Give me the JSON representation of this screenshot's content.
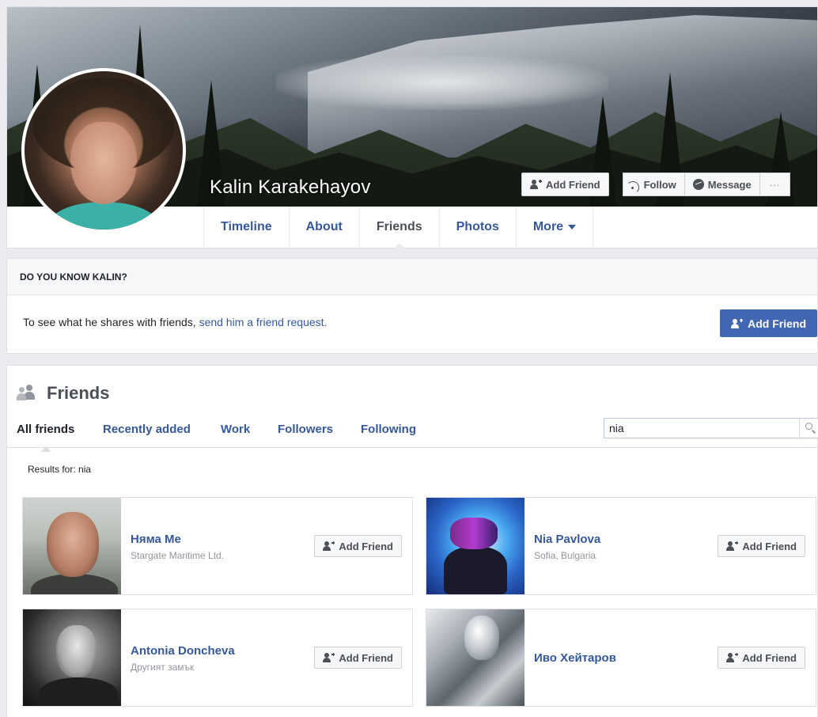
{
  "profile": {
    "name": "Kalin Karakehayov"
  },
  "cover_actions": {
    "add_friend": "Add Friend",
    "follow": "Follow",
    "message": "Message",
    "more": "···"
  },
  "nav": {
    "tabs": [
      {
        "label": "Timeline"
      },
      {
        "label": "About"
      },
      {
        "label": "Friends"
      },
      {
        "label": "Photos"
      },
      {
        "label": "More"
      }
    ]
  },
  "know": {
    "heading": "DO YOU KNOW KALIN?",
    "text": "To see what he shares with friends, ",
    "link": "send him a friend request.",
    "button": "Add Friend"
  },
  "friends": {
    "title": "Friends",
    "subtabs": [
      {
        "label": "All friends"
      },
      {
        "label": "Recently added"
      },
      {
        "label": "Work"
      },
      {
        "label": "Followers"
      },
      {
        "label": "Following"
      }
    ],
    "search_value": "nia",
    "results_label": "Results for: nia",
    "cards": [
      {
        "name": "Няма Ме",
        "sub": "Stargate Maritime Ltd.",
        "button": "Add Friend"
      },
      {
        "name": "Nia Pavlova",
        "sub": "Sofia, Bulgaria",
        "button": "Add Friend"
      },
      {
        "name": "Antonia Doncheva",
        "sub": "Другият замък",
        "button": "Add Friend"
      },
      {
        "name": "Иво Хейтаров",
        "sub": "",
        "button": "Add Friend"
      }
    ]
  },
  "colors": {
    "link": "#365899",
    "primary": "#4267b2",
    "background": "#e9ebee"
  }
}
